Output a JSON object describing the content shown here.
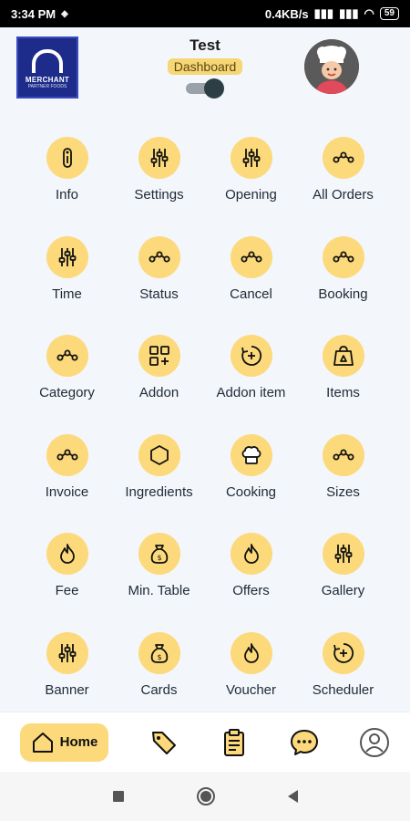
{
  "status_bar": {
    "time": "3:34 PM",
    "network_speed": "0.4KB/s",
    "battery": "59"
  },
  "header": {
    "logo_brand": "MERCHANT",
    "logo_sub": "PARTNER FOODS",
    "title": "Test",
    "badge": "Dashboard",
    "dashboard_toggle_on": true
  },
  "menu": [
    {
      "label": "Info",
      "icon": "info-icon"
    },
    {
      "label": "Settings",
      "icon": "sliders-icon"
    },
    {
      "label": "Opening",
      "icon": "sliders-icon"
    },
    {
      "label": "All Orders",
      "icon": "route-icon"
    },
    {
      "label": "Time",
      "icon": "sliders-icon"
    },
    {
      "label": "Status",
      "icon": "route-icon"
    },
    {
      "label": "Cancel",
      "icon": "route-icon"
    },
    {
      "label": "Booking",
      "icon": "route-icon"
    },
    {
      "label": "Category",
      "icon": "route-icon"
    },
    {
      "label": "Addon",
      "icon": "grid-plus-icon"
    },
    {
      "label": "Addon item",
      "icon": "add-circle-icon"
    },
    {
      "label": "Items",
      "icon": "scale-icon"
    },
    {
      "label": "Invoice",
      "icon": "route-icon"
    },
    {
      "label": "Ingredients",
      "icon": "hexagon-icon"
    },
    {
      "label": "Cooking",
      "icon": "chef-hat-icon"
    },
    {
      "label": "Sizes",
      "icon": "route-icon"
    },
    {
      "label": "Fee",
      "icon": "flame-icon"
    },
    {
      "label": "Min. Table",
      "icon": "money-bag-icon"
    },
    {
      "label": "Offers",
      "icon": "flame-icon"
    },
    {
      "label": "Gallery",
      "icon": "sliders-icon"
    },
    {
      "label": "Banner",
      "icon": "sliders-icon"
    },
    {
      "label": "Cards",
      "icon": "money-bag-icon"
    },
    {
      "label": "Voucher",
      "icon": "flame-icon"
    },
    {
      "label": "Scheduler",
      "icon": "add-circle-icon"
    }
  ],
  "bottom_nav": {
    "home_label": "Home",
    "items": [
      "tag-icon",
      "clipboard-icon",
      "chat-icon",
      "profile-icon"
    ]
  },
  "colors": {
    "accent": "#fcd97a",
    "background": "#f3f6fa"
  }
}
